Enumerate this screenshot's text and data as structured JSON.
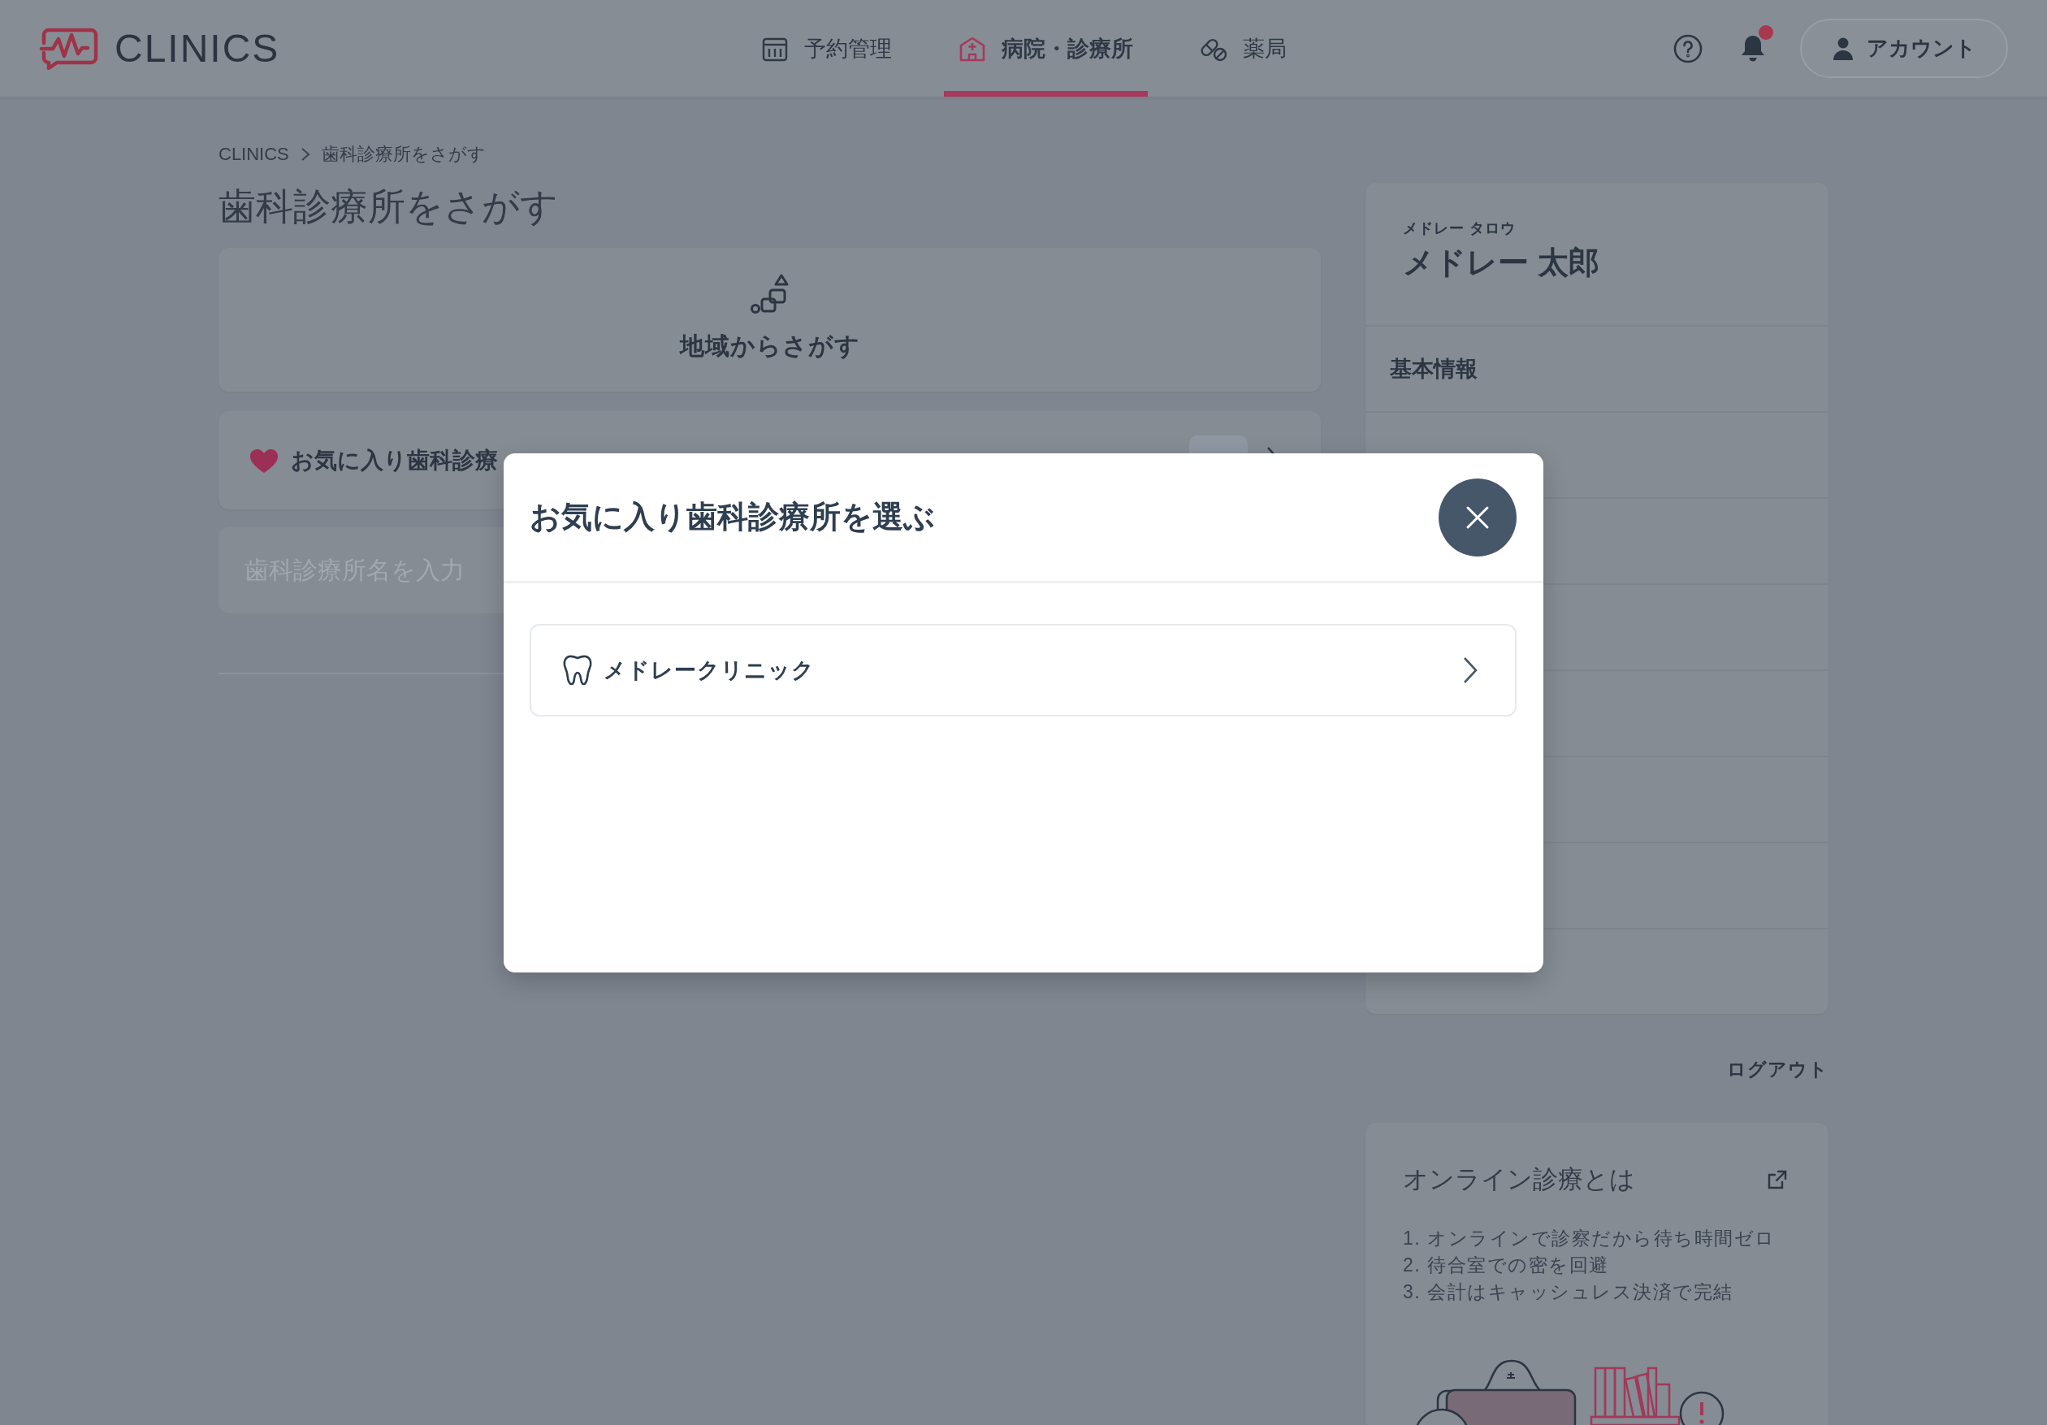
{
  "header": {
    "logo": "CLINICS",
    "nav": [
      {
        "label": "予約管理",
        "selected": false
      },
      {
        "label": "病院・診療所",
        "selected": true
      },
      {
        "label": "薬局",
        "selected": false
      }
    ],
    "notifications": {
      "unread": true
    },
    "account": "アカウント"
  },
  "breadcrumb": [
    "CLINICS",
    "歯科診療所をさがす"
  ],
  "title": "歯科診療所をさがす",
  "region_search": {
    "label": "地域からさがす"
  },
  "favorites": {
    "label": "お気に入り歯科診療"
  },
  "search": {
    "placeholder": "歯科診療所名を入力"
  },
  "profile": {
    "name_kana": "メドレー タロウ",
    "name": "メドレー 太郎",
    "menu": [
      "基本情報"
    ]
  },
  "logout": "ログアウト",
  "online_info": {
    "title": "オンライン診療とは",
    "points": [
      "1. オンラインで診察だから待ち時間ゼロ",
      "2. 待合室での密を回避",
      "3. 会計はキャッシュレス決済で完結"
    ]
  },
  "modal": {
    "title": "お気に入り歯科診療所を選ぶ",
    "clinics": [
      {
        "name": "メドレークリニック"
      }
    ]
  }
}
